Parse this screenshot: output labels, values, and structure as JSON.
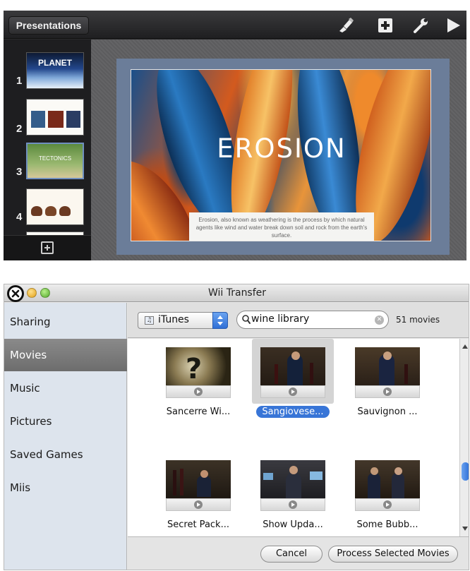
{
  "keynote": {
    "presentations_label": "Presentations",
    "toolbar_icons": [
      "brush-icon",
      "add-slide-icon",
      "wrench-icon",
      "play-icon"
    ],
    "thumbnails": [
      {
        "number": "1",
        "text": "PLANET"
      },
      {
        "number": "2",
        "text": ""
      },
      {
        "number": "3",
        "text": "TECTONICS"
      },
      {
        "number": "4",
        "text": ""
      }
    ],
    "slide": {
      "title": "EROSION",
      "caption": "Erosion, also known as weathering is the process by which natural agents like wind and water break down soil and rock from the earth's surface."
    }
  },
  "wii": {
    "title": "Wii Transfer",
    "sidebar": [
      {
        "label": "Sharing",
        "selected": false
      },
      {
        "label": "Movies",
        "selected": true
      },
      {
        "label": "Music",
        "selected": false
      },
      {
        "label": "Pictures",
        "selected": false
      },
      {
        "label": "Saved Games",
        "selected": false
      },
      {
        "label": "Miis",
        "selected": false
      }
    ],
    "source": {
      "label": "iTunes"
    },
    "search": {
      "value": "wine library"
    },
    "count": "51 movies",
    "movies": [
      {
        "label": "Sancerre Wi...",
        "selected": false
      },
      {
        "label": "Sangiovese...",
        "selected": true
      },
      {
        "label": "Sauvignon ...",
        "selected": false
      },
      {
        "label": "Secret Pack...",
        "selected": false
      },
      {
        "label": "Show Upda...",
        "selected": false
      },
      {
        "label": "Some Bubb...",
        "selected": false
      }
    ],
    "buttons": {
      "cancel": "Cancel",
      "process": "Process Selected Movies"
    }
  }
}
